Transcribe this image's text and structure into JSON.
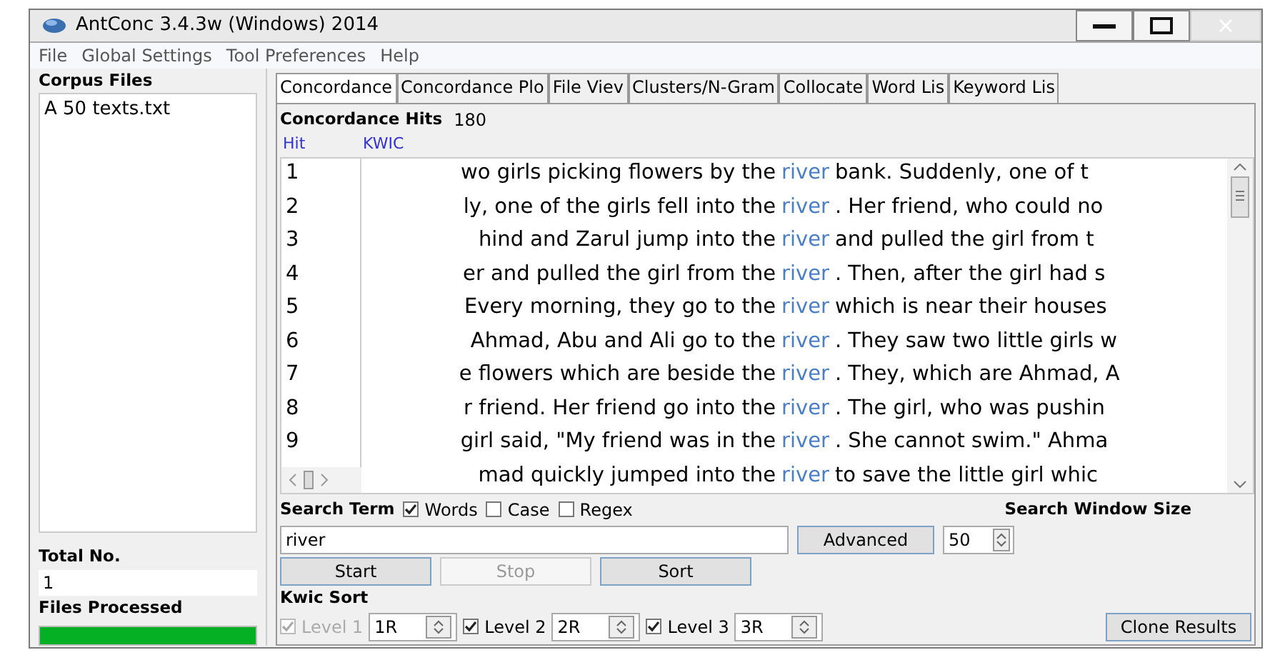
{
  "window": {
    "title": "AntConc 3.4.3w (Windows) 2014"
  },
  "menu": [
    "File",
    "Global Settings",
    "Tool Preferences",
    "Help"
  ],
  "corpus_files": {
    "heading": "Corpus Files",
    "items": [
      {
        "label": "A 50 texts.txt",
        "selected": false
      }
    ]
  },
  "total": {
    "label": "Total No.",
    "value": "1"
  },
  "files_processed": {
    "label": "Files Processed",
    "level": 1
  },
  "tabs": [
    {
      "label": "Concordance",
      "selected": true
    },
    {
      "label": "Concordance Plo",
      "selected": false
    },
    {
      "label": "File Viev",
      "selected": false
    },
    {
      "label": "Clusters/N-Gram",
      "selected": false
    },
    {
      "label": "Collocate",
      "selected": false
    },
    {
      "label": "Word Lis",
      "selected": false
    },
    {
      "label": "Keyword Lis",
      "selected": false
    }
  ],
  "hits": {
    "label": "Concordance Hits",
    "value": "180"
  },
  "columns": [
    "Hit",
    "KWIC"
  ],
  "rows": [
    {
      "hit": "1",
      "left": "wo girls picking flowers by the",
      "key": "river",
      "right": "bank.  Suddenly, one of t"
    },
    {
      "hit": "2",
      "left": "ly, one of the girls fell into the",
      "key": "river",
      "right": ". Her friend, who could no"
    },
    {
      "hit": "3",
      "left": "hind and Zarul  jump into the",
      "key": "river",
      "right": "and pulled the girl from t"
    },
    {
      "hit": "4",
      "left": "er and pulled the girl from the",
      "key": "river",
      "right": ".  Then, after the girl had s"
    },
    {
      "hit": "5",
      "left": "Every morning, they go to the",
      "key": "river",
      "right": "which is near their houses"
    },
    {
      "hit": "6",
      "left": "Ahmad, Abu and Ali go to the",
      "key": "river",
      "right": ". They saw two little girls w"
    },
    {
      "hit": "7",
      "left": "e flowers which are beside the",
      "key": "river",
      "right": ". They, which are Ahmad, A"
    },
    {
      "hit": "8",
      "left": "r friend. Her friend go into the",
      "key": "river",
      "right": ". The girl, who was pushin"
    },
    {
      "hit": "9",
      "left": "girl said, \"My friend was in the",
      "key": "river",
      "right": ". She cannot swim.\" Ahma"
    },
    {
      "left": "mad quickly jumped  into the",
      "key": "river",
      "right": "to save the little girl whic"
    }
  ],
  "search": {
    "label": "Search Term",
    "options": [
      {
        "label": "Words",
        "checked": true
      },
      {
        "label": "Case",
        "checked": false
      },
      {
        "label": "Regex",
        "checked": false
      }
    ],
    "value": "river",
    "advanced": "Advanced",
    "window_label": "Search Window Size",
    "window_value": "50"
  },
  "buttons": [
    {
      "label": "Start",
      "disabled": false
    },
    {
      "label": "Stop",
      "disabled": true
    },
    {
      "label": "Sort",
      "disabled": false
    }
  ],
  "kwic_sort": {
    "label": "Kwic Sort",
    "levels": [
      {
        "label": "Level 1",
        "checked": true,
        "disabled": true,
        "value": "1R"
      },
      {
        "label": "Level 2",
        "checked": true,
        "disabled": false,
        "value": "2R"
      },
      {
        "label": "Level 3",
        "checked": true,
        "disabled": false,
        "value": "3R"
      }
    ]
  },
  "clone": "Clone Results"
}
